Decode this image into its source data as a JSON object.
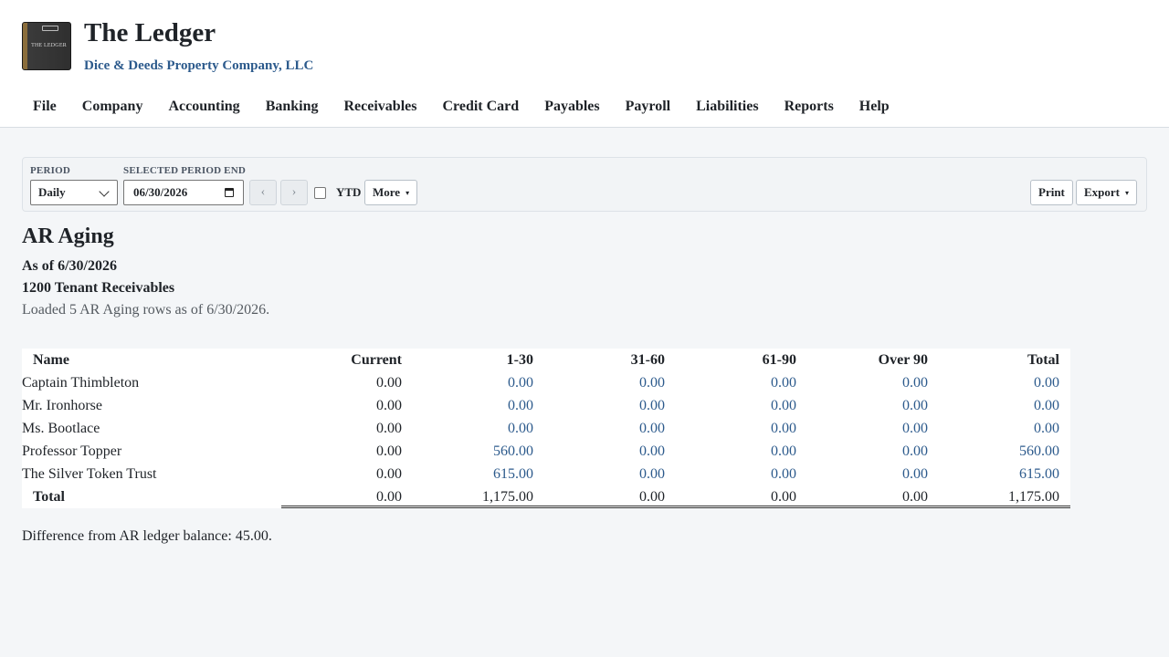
{
  "app": {
    "title": "The Ledger",
    "company": "Dice & Deeds Property Company, LLC",
    "logo_text": "THE LEDGER"
  },
  "menu": [
    "File",
    "Company",
    "Accounting",
    "Banking",
    "Receivables",
    "Credit Card",
    "Payables",
    "Payroll",
    "Liabilities",
    "Reports",
    "Help"
  ],
  "toolbar": {
    "period_label": "PERIOD",
    "period_value": "Daily",
    "period_end_label": "SELECTED PERIOD END",
    "period_end_value": "06/30/2026",
    "prev_label": "‹",
    "next_label": "›",
    "ytd_label": "YTD",
    "ytd_checked": false,
    "more_label": "More",
    "print_label": "Print",
    "export_label": "Export",
    "caret": "▾"
  },
  "report": {
    "title": "AR Aging",
    "as_of": "As of 6/30/2026",
    "account": "1200 Tenant Receivables",
    "status": "Loaded 5 AR Aging rows as of 6/30/2026.",
    "columns": [
      "Name",
      "Current",
      "1-30",
      "31-60",
      "61-90",
      "Over 90",
      "Total"
    ],
    "rows": [
      {
        "name": "Captain Thimbleton",
        "current": "0.00",
        "d1_30": "0.00",
        "d31_60": "0.00",
        "d61_90": "0.00",
        "over90": "0.00",
        "total": "0.00"
      },
      {
        "name": "Mr. Ironhorse",
        "current": "0.00",
        "d1_30": "0.00",
        "d31_60": "0.00",
        "d61_90": "0.00",
        "over90": "0.00",
        "total": "0.00"
      },
      {
        "name": "Ms. Bootlace",
        "current": "0.00",
        "d1_30": "0.00",
        "d31_60": "0.00",
        "d61_90": "0.00",
        "over90": "0.00",
        "total": "0.00"
      },
      {
        "name": "Professor Topper",
        "current": "0.00",
        "d1_30": "560.00",
        "d31_60": "0.00",
        "d61_90": "0.00",
        "over90": "0.00",
        "total": "560.00"
      },
      {
        "name": "The Silver Token Trust",
        "current": "0.00",
        "d1_30": "615.00",
        "d31_60": "0.00",
        "d61_90": "0.00",
        "over90": "0.00",
        "total": "615.00"
      }
    ],
    "totals": {
      "name": "Total",
      "current": "0.00",
      "d1_30": "1,175.00",
      "d31_60": "0.00",
      "d61_90": "0.00",
      "over90": "0.00",
      "total": "1,175.00"
    },
    "difference": "Difference from AR ledger balance: 45.00."
  },
  "colors": {
    "link": "#2c5a8c",
    "background": "#f4f6f8"
  }
}
